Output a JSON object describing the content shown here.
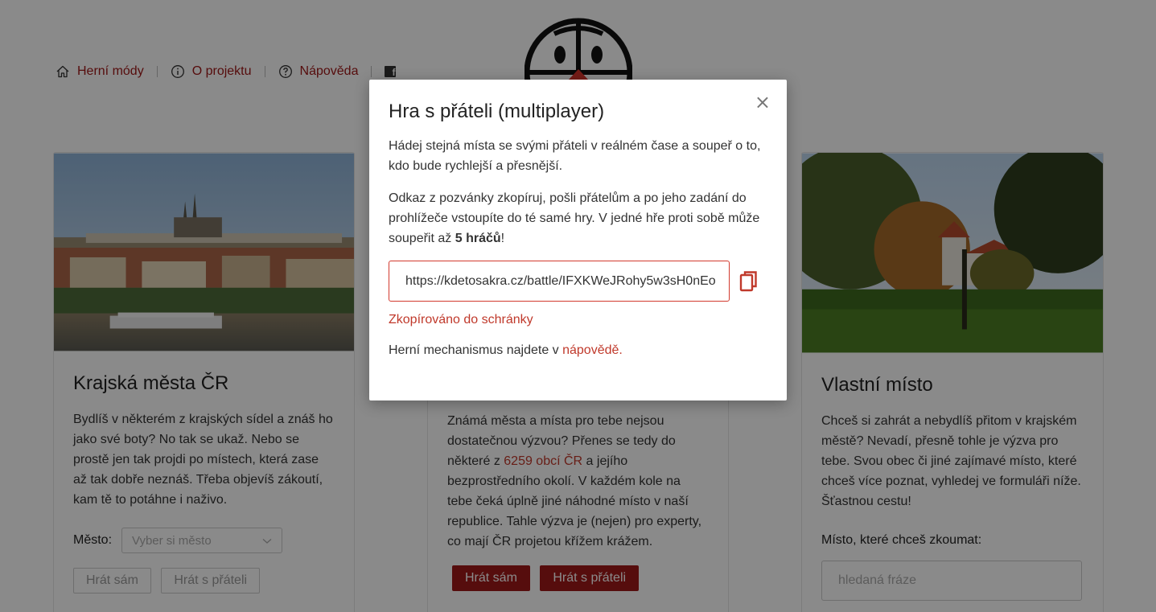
{
  "nav": {
    "items": [
      {
        "label": "Herní módy",
        "icon": "home-icon"
      },
      {
        "label": "O projektu",
        "icon": "info-icon"
      },
      {
        "label": "Nápověda",
        "icon": "help-icon"
      }
    ],
    "facebook_icon": "facebook-icon"
  },
  "logo": {
    "icon": "globe-logo-icon"
  },
  "cards": {
    "regional": {
      "title": "Krajská města ČR",
      "text": "Bydlíš v některém z krajských sídel a znáš ho jako své boty? No tak se ukaž. Nebo se prostě jen tak projdi po místech, která zase až tak dobře neznáš. Třeba objevíš zákoutí, kam tě to potáhne i naživo.",
      "city_label": "Město:",
      "city_placeholder": "Vyber si město",
      "play_solo": "Hrát sám",
      "play_friends": "Hrát s přáteli"
    },
    "random": {
      "text_before": "Známá města a místa pro tebe nejsou dostatečnou výzvou? Přenes se tedy do některé z ",
      "link": "6259 obcí ČR",
      "text_after": " a jejího bezprostředního okolí. V každém kole na tebe čeká úplně jiné náhodné místo v naší republice. Tahle výzva je (nejen) pro experty, co mají ČR projetou křížem krážem.",
      "play_solo": "Hrát sám",
      "play_friends": "Hrát s přáteli"
    },
    "custom": {
      "title": "Vlastní místo",
      "text": "Chceš si zahrát a nebydlíš přitom v krajském městě? Nevadí, přesně tohle je výzva pro tebe. Svou obec či jiné zajímavé místo, které chceš více poznat, vyhledej ve formuláři níže. Šťastnou cestu!",
      "place_label": "Místo, které chceš zkoumat:",
      "search_placeholder": "hledaná fráze"
    }
  },
  "modal": {
    "title": "Hra s přáteli (multiplayer)",
    "p1": "Hádej stejná místa se svými přáteli v reálném čase a soupeř o to, kdo bude rychlejší a přesnější.",
    "p2_before": "Odkaz z pozvánky zkopíruj, pošli přátelům a po jeho zadání do prohlížeče vstoupíte do té samé hry. V jedné hře proti sobě může soupeřit až ",
    "p2_bold": "5 hráčů",
    "p2_after": "!",
    "url": "https://kdetosakra.cz/battle/IFXKWeJRohy5w3sH0nEo",
    "copied": "Zkopírováno do schránky",
    "footer_before": "Herní mechanismus najdete v ",
    "footer_link": "nápovědě.",
    "close": "×"
  },
  "colors": {
    "accent": "#a01818",
    "link": "#c0392b",
    "overlay": "rgba(0,0,0,0.46)"
  }
}
